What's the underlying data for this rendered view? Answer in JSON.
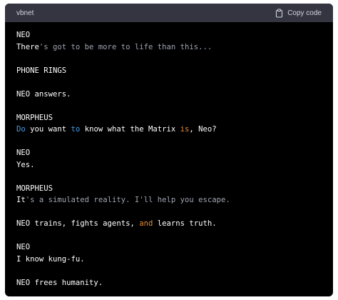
{
  "header": {
    "language": "vbnet",
    "copy_label": "Copy code",
    "copy_icon": "clipboard-icon"
  },
  "colors": {
    "panel_background": "#000000",
    "header_background": "#343541",
    "plain_text": "#ffffff",
    "string_gray": "#9ca3af",
    "keyword_blue": "#4a9ee8",
    "keyword_orange": "#e58b3a"
  },
  "code_lines": [
    [
      {
        "text": "NEO",
        "style": "plain"
      }
    ],
    [
      {
        "text": "There",
        "style": "plain"
      },
      {
        "text": "'s got to be more to life than this...",
        "style": "gray"
      }
    ],
    [],
    [
      {
        "text": "PHONE RINGS",
        "style": "plain"
      }
    ],
    [],
    [
      {
        "text": "NEO answers.",
        "style": "plain"
      }
    ],
    [],
    [
      {
        "text": "MORPHEUS",
        "style": "plain"
      }
    ],
    [
      {
        "text": "Do",
        "style": "blue"
      },
      {
        "text": " you want ",
        "style": "plain"
      },
      {
        "text": "to",
        "style": "blue"
      },
      {
        "text": " know what the Matrix ",
        "style": "plain"
      },
      {
        "text": "is",
        "style": "orange"
      },
      {
        "text": ", Neo?",
        "style": "plain"
      }
    ],
    [],
    [
      {
        "text": "NEO",
        "style": "plain"
      }
    ],
    [
      {
        "text": "Yes.",
        "style": "plain"
      }
    ],
    [],
    [
      {
        "text": "MORPHEUS",
        "style": "plain"
      }
    ],
    [
      {
        "text": "It",
        "style": "plain"
      },
      {
        "text": "'s a simulated reality. I'll help you escape.",
        "style": "gray"
      }
    ],
    [],
    [
      {
        "text": "NEO trains, fights agents, ",
        "style": "plain"
      },
      {
        "text": "and",
        "style": "orange"
      },
      {
        "text": " learns truth.",
        "style": "plain"
      }
    ],
    [],
    [
      {
        "text": "NEO",
        "style": "plain"
      }
    ],
    [
      {
        "text": "I know kung-fu.",
        "style": "plain"
      }
    ],
    [],
    [
      {
        "text": "NEO frees humanity.",
        "style": "plain"
      }
    ]
  ]
}
